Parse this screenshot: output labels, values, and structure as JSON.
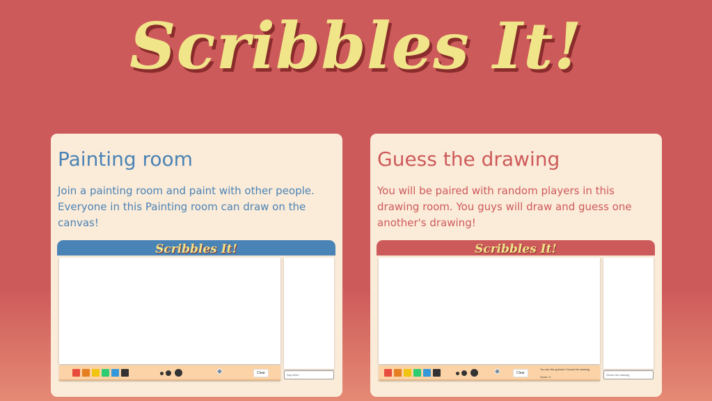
{
  "title": "Scribbles It!",
  "cards": {
    "painting": {
      "heading": "Painting room",
      "description": "Join a painting room and paint with other people. Everyone in this Painting room can draw on the canvas!",
      "preview_title": "Scribbles It!",
      "input_placeholder": "Say hello!",
      "clear_label": "Clear"
    },
    "guess": {
      "heading": "Guess the drawing",
      "description": "You will be paired with random players in this drawing room. You guys will draw and guess one another's drawing!",
      "preview_title": "Scribbles It!",
      "input_placeholder": "Guess the drawing",
      "clear_label": "Clear",
      "status_line": "You are the guesser! Guess the drawing",
      "score_line": "Score: 3"
    }
  },
  "palette": [
    "#e74c3c",
    "#e67e22",
    "#f1c40f",
    "#2ecc71",
    "#3498db",
    "#333333"
  ],
  "colors": {
    "background": "#cd5a5a",
    "card": "#fbebd9",
    "blue_accent": "#4a83b5",
    "red_accent": "#cd5a5a",
    "title_yellow": "#f1e58a",
    "toolbar": "#fcd3a6"
  },
  "icons": {
    "eraser": "eraser-icon",
    "brush_sizes": "brush-size-icons"
  }
}
